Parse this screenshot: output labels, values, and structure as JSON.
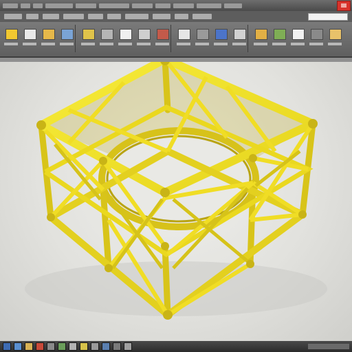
{
  "window": {
    "close_icon": "close-icon",
    "close_color": "#d8322b"
  },
  "ribbon": {
    "tools": [
      {
        "icon": "home-icon",
        "color": "#f2c830"
      },
      {
        "icon": "document-icon",
        "color": "#e8e8e8"
      },
      {
        "icon": "folder-icon",
        "color": "#e6b84a"
      },
      {
        "icon": "shapes-icon",
        "color": "#7aa4d6"
      },
      {
        "icon": "cube-icon",
        "color": "#e0c34a"
      },
      {
        "icon": "globe-icon",
        "color": "#b5b5b5"
      },
      {
        "icon": "image-icon",
        "color": "#f0f0f0"
      },
      {
        "icon": "grid-icon",
        "color": "#cfcfcf"
      },
      {
        "icon": "refresh-icon",
        "color": "#c45a4a"
      },
      {
        "icon": "layout-icon",
        "color": "#e6e6e6"
      },
      {
        "icon": "gear-icon",
        "color": "#9a9a9a"
      },
      {
        "icon": "chart-icon",
        "color": "#4c74c9"
      },
      {
        "icon": "curve-icon",
        "color": "#d1d1d1"
      },
      {
        "icon": "frame-icon",
        "color": "#e2b045"
      },
      {
        "icon": "tree-icon",
        "color": "#7fae55"
      },
      {
        "icon": "bird-icon",
        "color": "#f1f1f1"
      },
      {
        "icon": "sphere-icon",
        "color": "#8a8a8a"
      },
      {
        "icon": "pencil-icon",
        "color": "#e8c26a"
      }
    ]
  },
  "model": {
    "name_icon": "truss-ring-model",
    "color": "#f0e22a"
  },
  "taskbar": {
    "apps": [
      {
        "icon": "start-icon",
        "color": "#3d6bb3"
      },
      {
        "icon": "browser-icon",
        "color": "#5a8fd0"
      },
      {
        "icon": "folder-icon",
        "color": "#d9b255"
      },
      {
        "icon": "media-icon",
        "color": "#c94a3a"
      },
      {
        "icon": "app-icon",
        "color": "#8a8a8a"
      },
      {
        "icon": "app-icon",
        "color": "#6a9e5a"
      },
      {
        "icon": "app-icon",
        "color": "#b3b3b3"
      },
      {
        "icon": "app-icon",
        "color": "#d6c24a"
      },
      {
        "icon": "app-icon",
        "color": "#9a9a9a"
      },
      {
        "icon": "app-icon",
        "color": "#5a7fb0"
      },
      {
        "icon": "app-icon",
        "color": "#7a7a7a"
      },
      {
        "icon": "app-icon",
        "color": "#a0a0a0"
      }
    ]
  }
}
